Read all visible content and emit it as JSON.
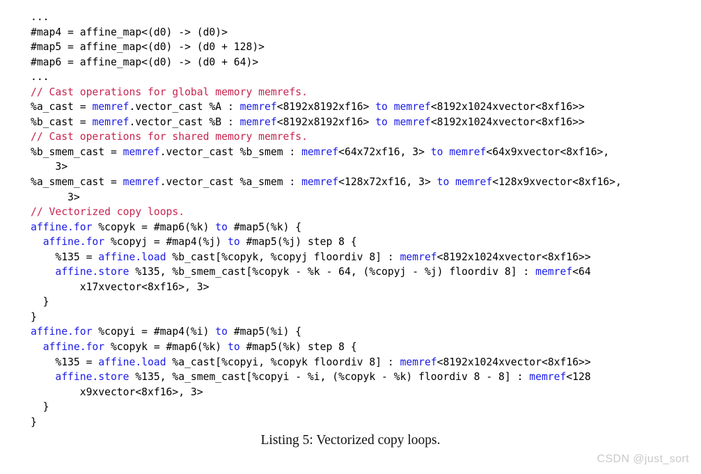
{
  "document": {
    "caption": "Listing 5: Vectorized copy loops.",
    "watermark": "CSDN @just_sort"
  },
  "colors": {
    "keyword": "#1a1ae6",
    "comment": "#c7254e",
    "plain": "#000000",
    "background": "#ffffff",
    "watermark": "#c9c9c9"
  },
  "code": {
    "language": "mlir",
    "lines": [
      {
        "id": 0,
        "segments": [
          {
            "t": "...",
            "c": "pln"
          }
        ]
      },
      {
        "id": 1,
        "segments": [
          {
            "t": "#map4 = affine_map<(d0) -> (d0)>",
            "c": "pln"
          }
        ]
      },
      {
        "id": 2,
        "segments": [
          {
            "t": "#map5 = affine_map<(d0) -> (d0 + 128)>",
            "c": "pln"
          }
        ]
      },
      {
        "id": 3,
        "segments": [
          {
            "t": "#map6 = affine_map<(d0) -> (d0 + 64)>",
            "c": "pln"
          }
        ]
      },
      {
        "id": 4,
        "segments": [
          {
            "t": "...",
            "c": "pln"
          }
        ]
      },
      {
        "id": 5,
        "segments": [
          {
            "t": "// Cast operations for global memory memrefs.",
            "c": "cmt"
          }
        ]
      },
      {
        "id": 6,
        "segments": [
          {
            "t": "%a_cast = ",
            "c": "pln"
          },
          {
            "t": "memref",
            "c": "kw"
          },
          {
            "t": ".vector_cast %A : ",
            "c": "pln"
          },
          {
            "t": "memref",
            "c": "kw"
          },
          {
            "t": "<8192x8192xf16> ",
            "c": "pln"
          },
          {
            "t": "to",
            "c": "kw"
          },
          {
            "t": " ",
            "c": "pln"
          },
          {
            "t": "memref",
            "c": "kw"
          },
          {
            "t": "<8192x1024xvector<8xf16>>",
            "c": "pln"
          }
        ]
      },
      {
        "id": 7,
        "segments": [
          {
            "t": "%b_cast = ",
            "c": "pln"
          },
          {
            "t": "memref",
            "c": "kw"
          },
          {
            "t": ".vector_cast %B : ",
            "c": "pln"
          },
          {
            "t": "memref",
            "c": "kw"
          },
          {
            "t": "<8192x8192xf16> ",
            "c": "pln"
          },
          {
            "t": "to",
            "c": "kw"
          },
          {
            "t": " ",
            "c": "pln"
          },
          {
            "t": "memref",
            "c": "kw"
          },
          {
            "t": "<8192x1024xvector<8xf16>>",
            "c": "pln"
          }
        ]
      },
      {
        "id": 8,
        "segments": [
          {
            "t": "// Cast operations for shared memory memrefs.",
            "c": "cmt"
          }
        ]
      },
      {
        "id": 9,
        "segments": [
          {
            "t": "%b_smem_cast = ",
            "c": "pln"
          },
          {
            "t": "memref",
            "c": "kw"
          },
          {
            "t": ".vector_cast %b_smem : ",
            "c": "pln"
          },
          {
            "t": "memref",
            "c": "kw"
          },
          {
            "t": "<64x72xf16, 3> ",
            "c": "pln"
          },
          {
            "t": "to",
            "c": "kw"
          },
          {
            "t": " ",
            "c": "pln"
          },
          {
            "t": "memref",
            "c": "kw"
          },
          {
            "t": "<64x9xvector<8xf16>,",
            "c": "pln"
          }
        ]
      },
      {
        "id": 10,
        "segments": [
          {
            "t": "    3>",
            "c": "pln"
          }
        ]
      },
      {
        "id": 11,
        "segments": [
          {
            "t": "%a_smem_cast = ",
            "c": "pln"
          },
          {
            "t": "memref",
            "c": "kw"
          },
          {
            "t": ".vector_cast %a_smem : ",
            "c": "pln"
          },
          {
            "t": "memref",
            "c": "kw"
          },
          {
            "t": "<128x72xf16, 3> ",
            "c": "pln"
          },
          {
            "t": "to",
            "c": "kw"
          },
          {
            "t": " ",
            "c": "pln"
          },
          {
            "t": "memref",
            "c": "kw"
          },
          {
            "t": "<128x9xvector<8xf16>,",
            "c": "pln"
          }
        ]
      },
      {
        "id": 12,
        "segments": [
          {
            "t": "      3>",
            "c": "pln"
          }
        ]
      },
      {
        "id": 13,
        "segments": [
          {
            "t": "// Vectorized copy loops.",
            "c": "cmt"
          }
        ]
      },
      {
        "id": 14,
        "segments": [
          {
            "t": "affine.for",
            "c": "kw"
          },
          {
            "t": " %copyk = #map6(%k) ",
            "c": "pln"
          },
          {
            "t": "to",
            "c": "kw"
          },
          {
            "t": " #map5(%k) {",
            "c": "pln"
          }
        ]
      },
      {
        "id": 15,
        "segments": [
          {
            "t": "  ",
            "c": "pln"
          },
          {
            "t": "affine.for",
            "c": "kw"
          },
          {
            "t": " %copyj = #map4(%j) ",
            "c": "pln"
          },
          {
            "t": "to",
            "c": "kw"
          },
          {
            "t": " #map5(%j) step 8 {",
            "c": "pln"
          }
        ]
      },
      {
        "id": 16,
        "segments": [
          {
            "t": "    %135 = ",
            "c": "pln"
          },
          {
            "t": "affine.load",
            "c": "kw"
          },
          {
            "t": " %b_cast[%copyk, %copyj floordiv 8] : ",
            "c": "pln"
          },
          {
            "t": "memref",
            "c": "kw"
          },
          {
            "t": "<8192x1024xvector<8xf16>>",
            "c": "pln"
          }
        ]
      },
      {
        "id": 17,
        "segments": [
          {
            "t": "    ",
            "c": "pln"
          },
          {
            "t": "affine.store",
            "c": "kw"
          },
          {
            "t": " %135, %b_smem_cast[%copyk - %k - 64, (%copyj - %j) floordiv 8] : ",
            "c": "pln"
          },
          {
            "t": "memref",
            "c": "kw"
          },
          {
            "t": "<64",
            "c": "pln"
          }
        ]
      },
      {
        "id": 18,
        "segments": [
          {
            "t": "        x17xvector<8xf16>, 3>",
            "c": "pln"
          }
        ]
      },
      {
        "id": 19,
        "segments": [
          {
            "t": "  }",
            "c": "pln"
          }
        ]
      },
      {
        "id": 20,
        "segments": [
          {
            "t": "}",
            "c": "pln"
          }
        ]
      },
      {
        "id": 21,
        "segments": [
          {
            "t": "affine.for",
            "c": "kw"
          },
          {
            "t": " %copyi = #map4(%i) ",
            "c": "pln"
          },
          {
            "t": "to",
            "c": "kw"
          },
          {
            "t": " #map5(%i) {",
            "c": "pln"
          }
        ]
      },
      {
        "id": 22,
        "segments": [
          {
            "t": "  ",
            "c": "pln"
          },
          {
            "t": "affine.for",
            "c": "kw"
          },
          {
            "t": " %copyk = #map6(%k) ",
            "c": "pln"
          },
          {
            "t": "to",
            "c": "kw"
          },
          {
            "t": " #map5(%k) step 8 {",
            "c": "pln"
          }
        ]
      },
      {
        "id": 23,
        "segments": [
          {
            "t": "    %135 = ",
            "c": "pln"
          },
          {
            "t": "affine.load",
            "c": "kw"
          },
          {
            "t": " %a_cast[%copyi, %copyk floordiv 8] : ",
            "c": "pln"
          },
          {
            "t": "memref",
            "c": "kw"
          },
          {
            "t": "<8192x1024xvector<8xf16>>",
            "c": "pln"
          }
        ]
      },
      {
        "id": 24,
        "segments": [
          {
            "t": "    ",
            "c": "pln"
          },
          {
            "t": "affine.store",
            "c": "kw"
          },
          {
            "t": " %135, %a_smem_cast[%copyi - %i, (%copyk - %k) floordiv 8 - 8] : ",
            "c": "pln"
          },
          {
            "t": "memref",
            "c": "kw"
          },
          {
            "t": "<128",
            "c": "pln"
          }
        ]
      },
      {
        "id": 25,
        "segments": [
          {
            "t": "        x9xvector<8xf16>, 3>",
            "c": "pln"
          }
        ]
      },
      {
        "id": 26,
        "segments": [
          {
            "t": "  }",
            "c": "pln"
          }
        ]
      },
      {
        "id": 27,
        "segments": [
          {
            "t": "}",
            "c": "pln"
          }
        ]
      }
    ]
  }
}
